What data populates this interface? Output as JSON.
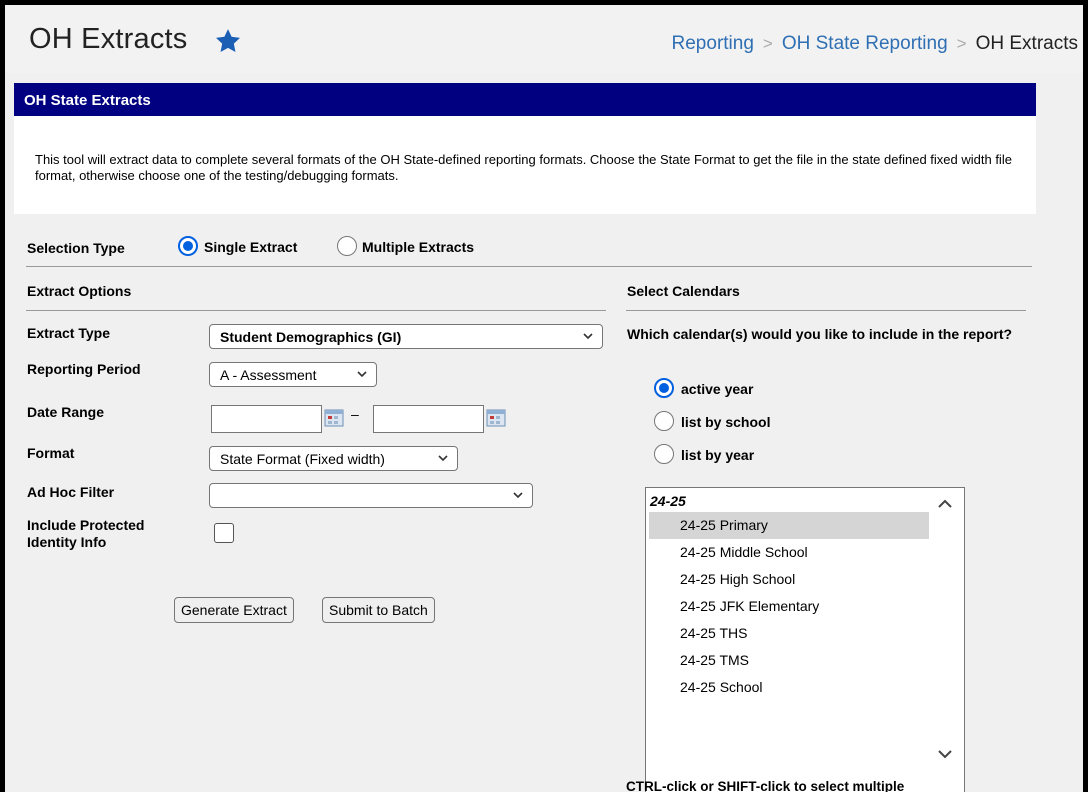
{
  "header": {
    "title": "OH Extracts",
    "breadcrumb": [
      "Reporting",
      "OH State Reporting",
      "OH Extracts"
    ]
  },
  "panel": {
    "title": "OH State Extracts",
    "description": "This tool will extract data to complete several formats of the OH State-defined reporting formats. Choose the State Format to get the file in the state defined fixed width file format, otherwise choose one of the testing/debugging formats."
  },
  "selection_type": {
    "label": "Selection Type",
    "options": [
      "Single Extract",
      "Multiple Extracts"
    ],
    "selected": "Single Extract"
  },
  "extract_options": {
    "heading": "Extract Options",
    "extract_type_label": "Extract Type",
    "extract_type_value": "Student Demographics (GI)",
    "reporting_period_label": "Reporting Period",
    "reporting_period_value": "A - Assessment",
    "date_range_label": "Date Range",
    "date_separator": "–",
    "format_label": "Format",
    "format_value": "State Format (Fixed width)",
    "ad_hoc_label": "Ad Hoc Filter",
    "ad_hoc_value": "",
    "protected_label_1": "Include Protected",
    "protected_label_2": "Identity Info",
    "generate_button": "Generate Extract",
    "batch_button": "Submit to Batch"
  },
  "calendars": {
    "heading": "Select Calendars",
    "prompt": "Which calendar(s) would you like to include in the report?",
    "options": [
      "active year",
      "list by school",
      "list by year"
    ],
    "selected": "active year",
    "group": "24-25",
    "items": [
      "24-25 Primary",
      "24-25 Middle School",
      "24-25 High School",
      "24-25 JFK Elementary",
      "24-25 THS",
      "24-25 TMS",
      "24-25 School"
    ],
    "selected_item": "24-25 Primary",
    "hint": "CTRL-click or SHIFT-click to select multiple"
  },
  "colors": {
    "title_bar": "#000080",
    "link": "#2f6fb3",
    "radio_accent": "#0060df",
    "star": "#1a5fb4"
  }
}
